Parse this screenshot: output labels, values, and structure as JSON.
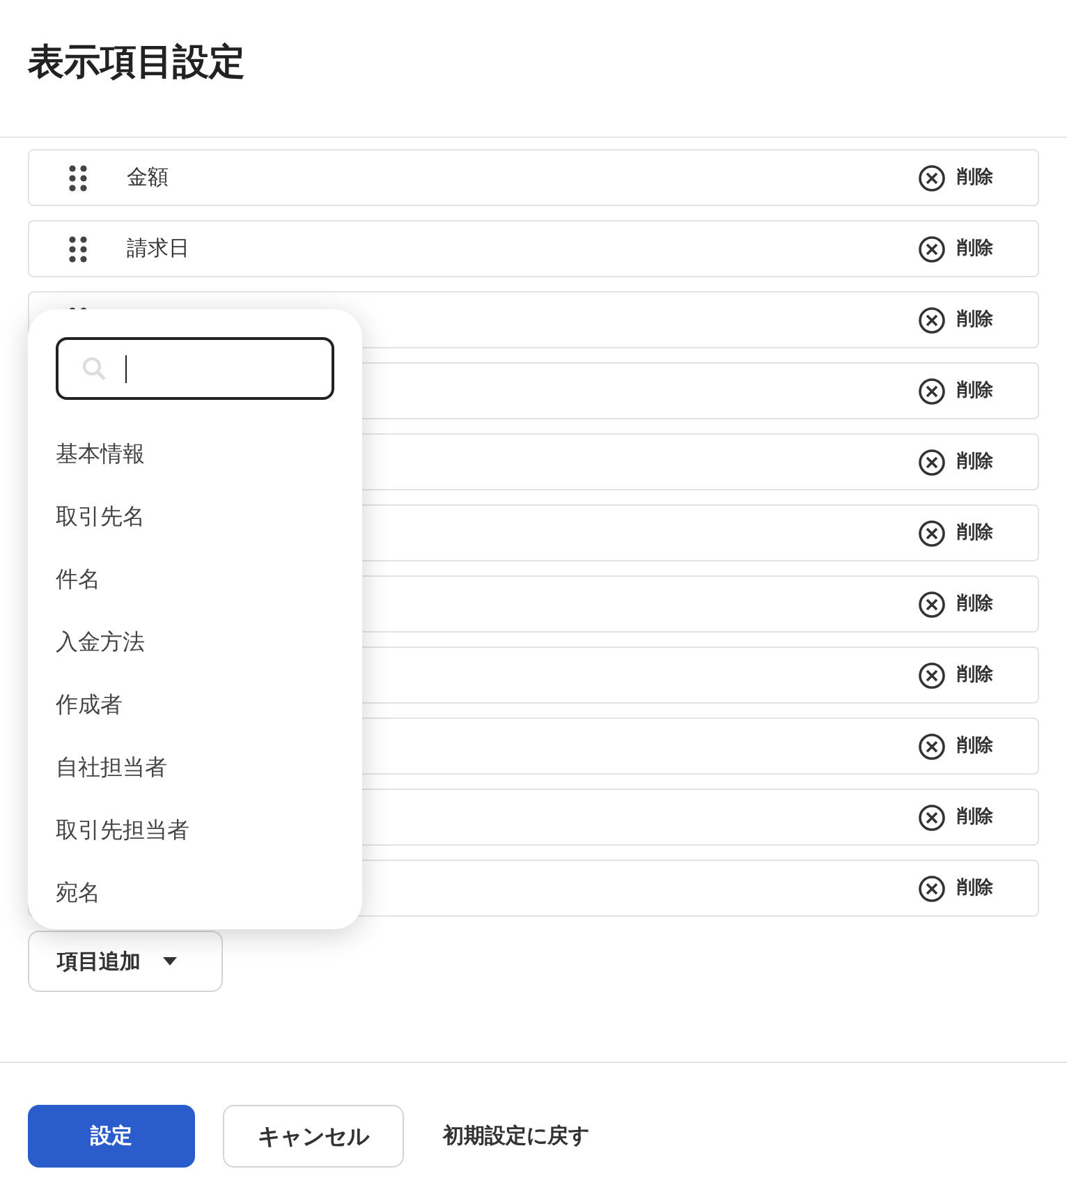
{
  "title": "表示項目設定",
  "rows": [
    {
      "label": "金額",
      "delete": "削除"
    },
    {
      "label": "請求日",
      "delete": "削除"
    },
    {
      "delete": "削除"
    },
    {
      "delete": "削除"
    },
    {
      "delete": "削除"
    },
    {
      "delete": "削除"
    },
    {
      "delete": "削除"
    },
    {
      "delete": "削除"
    },
    {
      "delete": "削除"
    },
    {
      "delete": "削除"
    },
    {
      "delete": "削除"
    }
  ],
  "dropdown": {
    "items": [
      "基本情報",
      "取引先名",
      "件名",
      "入金方法",
      "作成者",
      "自社担当者",
      "取引先担当者",
      "宛名"
    ]
  },
  "add_button": "項目追加",
  "footer": {
    "primary": "設定",
    "cancel": "キャンセル",
    "reset": "初期設定に戻す"
  }
}
